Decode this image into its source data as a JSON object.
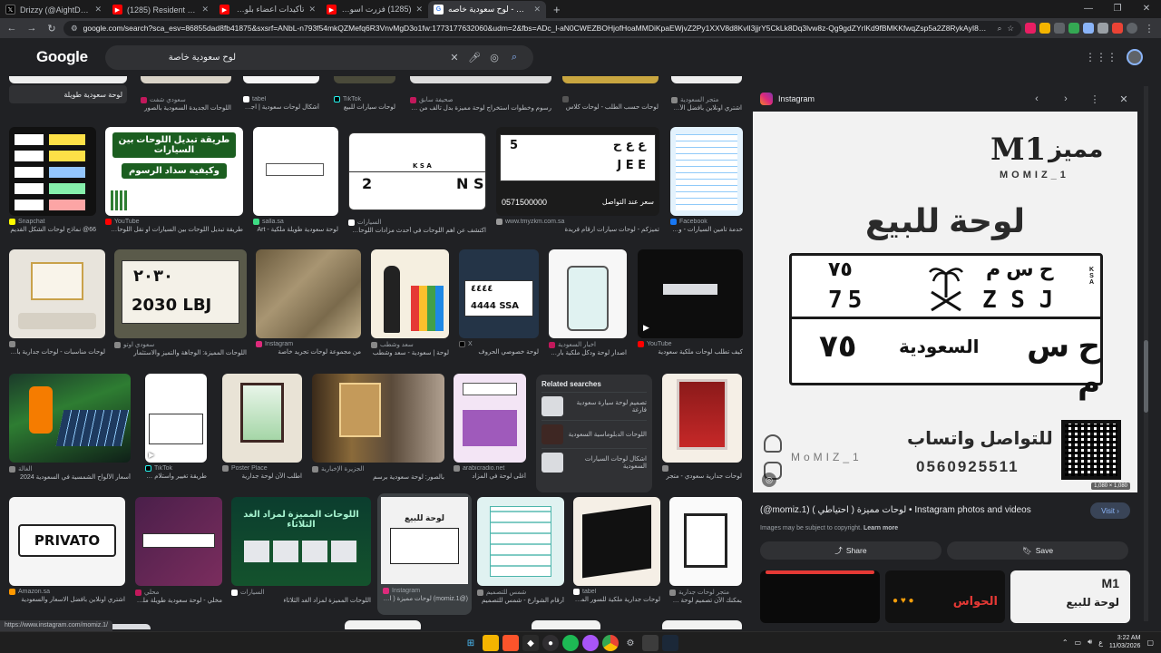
{
  "browser": {
    "tabs": [
      {
        "label": "Drizzy (@AightDrizzy) / X",
        "icon": "x-icon",
        "color": "#000000"
      },
      {
        "label": "(1285) Resident Evil 9 Requiem",
        "icon": "youtube-icon",
        "color": "#ff0000"
      },
      {
        "label": "تأكيدات اعضاء بلور يفطور اسهالهم",
        "icon": "youtube-icon",
        "color": "#ff0000"
      },
      {
        "label": "(1285) فزرت اسوي مزاد يطبيوون",
        "icon": "youtube-icon",
        "color": "#ff0000"
      },
      {
        "label": "لوح سعودية خاصه - Google Search",
        "icon": "google-icon",
        "color": "#4285f4"
      }
    ],
    "new_tab": "+",
    "url": "google.com/search?sca_esv=86855dad8fb41875&sxsrf=ANbL-n793f54mkQZMefq6R3VnvMgD3o1fw:1773177632060&udm=2&fbs=ADc_l-aN0CWEZBOHjofHoaMMDiKpaEWjvZ2Py1XXV8d8KvlI3jjrY5CkLk8Dq3lvw8z-Qg9gdZYrlKd9fBMKKfwqZsp5a2Z8RykAyI8QON1GKtCr4VT6OCYPo9zQfqtZwk7fy47BvpS4F6x8",
    "window_controls": [
      "—",
      "❐",
      "✕"
    ]
  },
  "google": {
    "logo": "Google",
    "query": "لوح سعودية خاصة"
  },
  "results": [
    {
      "source": "",
      "title": "لوحة سعودية طويلة"
    },
    {
      "source": "سعودي شفت",
      "title": "اللوحات الجديدة السعودية بالصور"
    },
    {
      "source": "tabel",
      "title": "أشكال لوحات سعودية | اجمل"
    },
    {
      "source": "TikTok",
      "title": "لوحات سيارات للبيع"
    },
    {
      "source": "صحيفة سابق",
      "title": "رسوم وخطوات استخراج لوحة مميزة بدل تالف من المرور"
    },
    {
      "source": "",
      "title": "لوحات حسب الطلب - لوحات كلاس"
    },
    {
      "source": "متجر السعودية",
      "title": "اشتري اونلاين بأفضل الأسعار"
    },
    {
      "source": "Snapchat",
      "title": "66@ نماذج لوحات الشكل القديم"
    },
    {
      "source": "YouTube",
      "title": "طريقة تبديل اللوحات بين السيارات او نقل اللوحات بين"
    },
    {
      "source": "salla.sa",
      "title": "لوحة سعودية طويلة ملكية - Art"
    },
    {
      "source": "السيارات",
      "title": "اكتشف عن اهم اللوحات في أحدث مزادات اللوحات بالسعودية"
    },
    {
      "source": "www.tmyzkm.com.sa",
      "title": "تميزكم - لوحات سيارات ارقام فريدة"
    },
    {
      "source": "Facebook",
      "title": "خدمة تأمين السيارات - وكالة"
    },
    {
      "source": "",
      "title": "لوحات مناسبات - لوحات جدارية بالسعودية"
    },
    {
      "source": "سعودي اوتو",
      "title": "اللوحات المميزة: الوجاهة والتميز والاستثمار"
    },
    {
      "source": "Instagram",
      "title": "من مجموعة لوحات تجريد خاصة"
    },
    {
      "source": "سعد وشطب",
      "title": "لوحة | سعودية - سعد وشطب"
    },
    {
      "source": "X",
      "title": "لوحة خصوصي الحروف"
    },
    {
      "source": "اخبار السعودية",
      "title": "اصدار لوحة ودكل ملكية بأرقام"
    },
    {
      "source": "YouTube",
      "title": "كيف تطلب لوحات ملكية سعودية"
    },
    {
      "source": "الغالة",
      "title": "أسعار الألواح الشمسية في السعودية 2024"
    },
    {
      "source": "TikTok",
      "title": "طريقة تغيير واستلام لوحة"
    },
    {
      "source": "Poster Place",
      "title": "اطلب الآن لوحة جدارية"
    },
    {
      "source": "الجزيرة الإخبارية",
      "title": "بالصور: لوحة سعودية برسم"
    },
    {
      "source": "arabicradio.net",
      "title": "أغلى لوحة في المزاد"
    },
    {
      "source": "",
      "title": "لوحات جدارية سعودي - متجر"
    },
    {
      "source": "Amazon.sa",
      "title": "اشتري اونلاين بأفضل الاسعار والسعودية"
    },
    {
      "source": "محلي",
      "title": "مخلي - لوحة سعودية طويلة ملكية"
    },
    {
      "source": "السيارات",
      "title": "اللوحات المميزة لمزاد الغد الثلاثاء"
    },
    {
      "source": "Instagram",
      "title": "(@momiz.1) لوحات مميزة ( احتياطي )"
    },
    {
      "source": "شمس للتصميم",
      "title": "أرقام الشوارع - شمس للتصميم"
    },
    {
      "source": "tabel",
      "title": "لوحات جدارية ملكية للسور الملوك"
    },
    {
      "source": "متجر لوحات جدارية",
      "title": "يمكنك الآن تصميم لوحة خاصة"
    }
  ],
  "related_searches": {
    "heading": "Related searches",
    "items": [
      "تصميم لوحة سيارة سعودية فارغة",
      "اللوحات الدبلوماسية السعودية",
      "اشكال لوحات السيارات السعودية"
    ]
  },
  "panel": {
    "source": "Instagram",
    "brand_ar": "مميز",
    "brand_en": "MOMIZ_1",
    "headline": "لوحة للبيع",
    "plate_ar_letters": "ح س م",
    "plate_ar_digits": "٧٥",
    "plate_en_letters": "Z S J",
    "plate_en_digits": "75",
    "plate_ksa": "KSA",
    "plate_bottom_ar": "ح س م",
    "plate_bottom_word": "السعودية",
    "plate_bottom_digits": "٧٥",
    "contact_label": "للتواصل واتساب",
    "handle": "MoMIZ_1",
    "phone": "0560925511",
    "dimensions": "1,080 × 1,080",
    "title": "(@momiz.1) لوحات مميزة ( احتياطي ) • Instagram photos and videos",
    "copyright": "Images may be subject to copyright.",
    "learn_more": "Learn more",
    "visit": "Visit",
    "share": "Share",
    "save": "Save",
    "related_thumb_text": "الحواس",
    "related_thumb_text2": "لوحة للبيع"
  },
  "result_thumbs": {
    "tile1_title": "طريقة تبديل اللوحات بين السيارات",
    "tile1_sub": "وكيفية سداد الرسوم",
    "plate2_letters": "K S A",
    "plate2_digits": "2",
    "plate2_latin": "N S",
    "plate3_ar": "ع ع ح",
    "plate3_en": "J E E",
    "plate3_digits": "5",
    "plate3_phone": "0571500000",
    "plate3_caption": "سعر عند التواصل",
    "plate4_ar": "٢٠٣٠",
    "plate4_en": "2030 LBJ",
    "plate5_ar": "٤٤٤٤",
    "plate5_en": "4444 SSA",
    "privato": "PRIVATO",
    "panel_thumb_text": "لوحة للبيع",
    "auction_title": "اللوحات المميزة لمزاد الغد الثلاثاء"
  },
  "status_url": "https://www.instagram.com/momiz.1/",
  "clock": {
    "time": "3:22 AM",
    "date": "11/03/2026"
  },
  "tray_lang": "ع"
}
